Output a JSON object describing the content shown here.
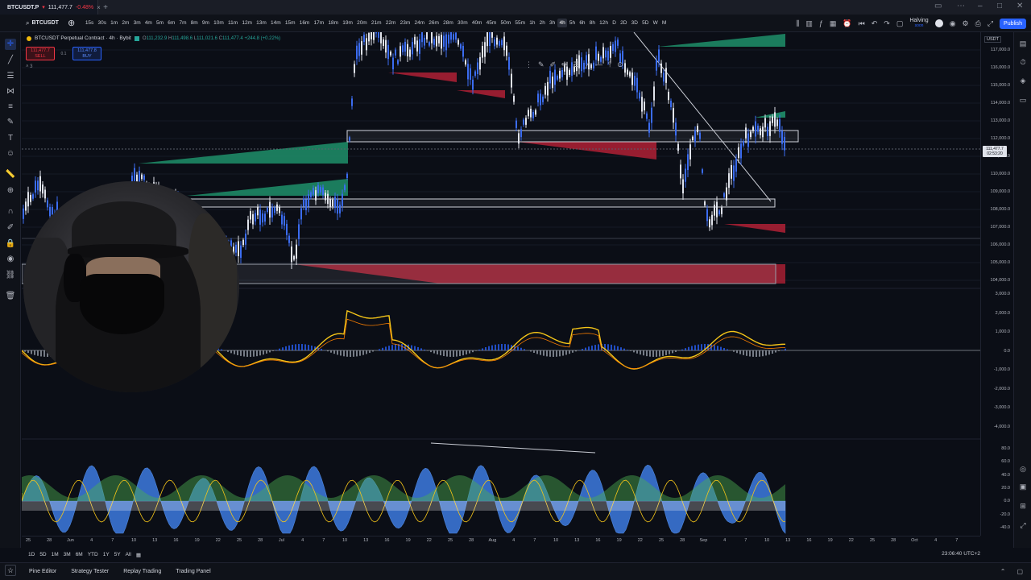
{
  "browser": {
    "tab_symbol": "BTCUSDT.P",
    "tab_price": "111,477.7",
    "tab_change": "-0.48%",
    "new_tab": "+"
  },
  "toolbar": {
    "symbol": "BTCUSDT",
    "intervals": [
      "15s",
      "30s",
      "1m",
      "2m",
      "3m",
      "4m",
      "5m",
      "6m",
      "7m",
      "8m",
      "9m",
      "10m",
      "11m",
      "12m",
      "13m",
      "14m",
      "15m",
      "16m",
      "17m",
      "18m",
      "19m",
      "20m",
      "21m",
      "22m",
      "23m",
      "24m",
      "26m",
      "28m",
      "30m",
      "40m",
      "45m",
      "50m",
      "55m",
      "1h",
      "2h",
      "3h",
      "4h",
      "5h",
      "6h",
      "8h",
      "12h",
      "D",
      "2D",
      "3D",
      "5D",
      "W",
      "M"
    ],
    "active_interval": "4h",
    "halving_label": "Halving",
    "halving_sub": "soon",
    "publish": "Publish"
  },
  "legend": {
    "title": "BTCUSDT Perpetual Contract · 4h · Bybit",
    "open": "111,232.9",
    "high": "111,498.6",
    "low": "111,021.6",
    "close": "111,477.4",
    "change": "+244.8 (+0.22%)"
  },
  "trade": {
    "sell_price": "111,477.7",
    "sell_label": "SELL",
    "spread": "0.1",
    "buy_price": "111,477.8",
    "buy_label": "BUY",
    "collapse": "˄ 3"
  },
  "price_axis": {
    "currency": "USDT",
    "labels": [
      "117,000.0",
      "116,000.0",
      "115,000.0",
      "114,000.0",
      "113,000.0",
      "112,000.0",
      "111,000.0",
      "110,000.0",
      "109,000.0",
      "108,000.0",
      "107,000.0",
      "106,000.0",
      "105,000.0",
      "104,000.0"
    ],
    "current_price": "111,477.7",
    "countdown": "02:53:20",
    "osc1_labels": [
      "3,000.0",
      "2,000.0",
      "1,000.0",
      "0.0",
      "-1,000.0",
      "-2,000.0",
      "-3,000.0",
      "-4,000.0"
    ],
    "osc2_labels": [
      "80.0",
      "60.0",
      "40.0",
      "20.0",
      "0.0",
      "-20.0",
      "-40.0"
    ]
  },
  "time_axis": [
    "25",
    "28",
    "Jun",
    "4",
    "7",
    "10",
    "13",
    "16",
    "19",
    "22",
    "25",
    "28",
    "Jul",
    "4",
    "7",
    "10",
    "13",
    "16",
    "19",
    "22",
    "25",
    "28",
    "Aug",
    "4",
    "7",
    "10",
    "13",
    "16",
    "19",
    "22",
    "25",
    "28",
    "Sep",
    "4",
    "7",
    "10",
    "13",
    "16",
    "19",
    "22",
    "25",
    "28",
    "Oct",
    "4",
    "7"
  ],
  "range_bar": {
    "ranges": [
      "1D",
      "5D",
      "1M",
      "3M",
      "6M",
      "YTD",
      "1Y",
      "5Y",
      "All"
    ],
    "clock": "23:06:40 UTC+2"
  },
  "bottom_tabs": [
    "Pine Editor",
    "Strategy Tester",
    "Replay Trading",
    "Trading Panel"
  ],
  "colors": {
    "accent": "#2962ff",
    "bull": "#26a69a",
    "bear": "#f23645",
    "candle": "#3b6cf0",
    "macd_line": "#f5c518",
    "green_zone": "#1f8f6a",
    "red_zone": "#b02035"
  }
}
